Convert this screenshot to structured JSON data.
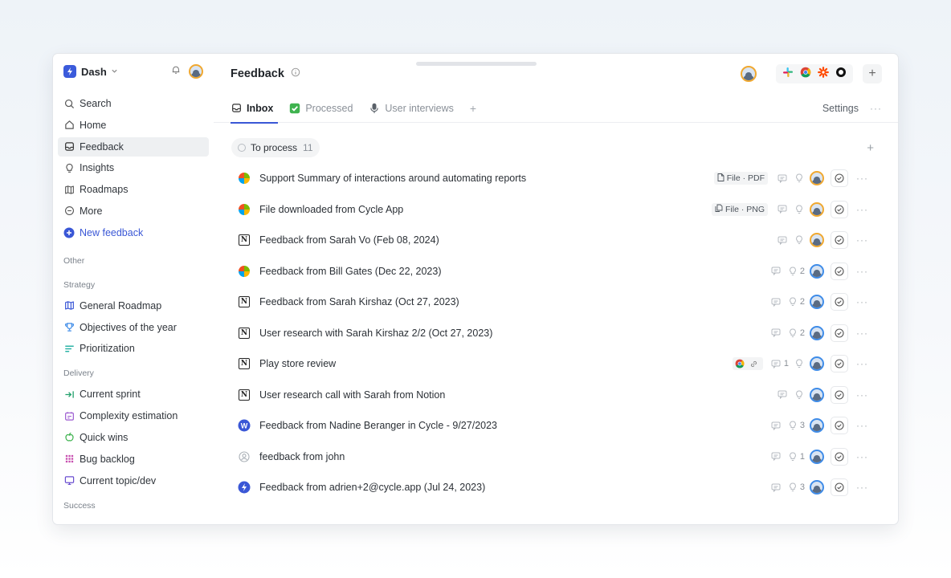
{
  "sidebar": {
    "workspace": "Dash",
    "nav": [
      {
        "label": "Search",
        "icon": "search-icon"
      },
      {
        "label": "Home",
        "icon": "home-icon"
      },
      {
        "label": "Feedback",
        "icon": "inbox-icon",
        "active": true
      },
      {
        "label": "Insights",
        "icon": "lightbulb-icon"
      },
      {
        "label": "Roadmaps",
        "icon": "map-icon"
      },
      {
        "label": "More",
        "icon": "more-circle-icon"
      },
      {
        "label": "New feedback",
        "icon": "plus-circle-icon"
      }
    ],
    "sections": {
      "other": "Other",
      "strategy": "Strategy",
      "delivery": "Delivery",
      "success": "Success"
    },
    "strategy_items": [
      {
        "label": "General Roadmap",
        "icon": "roadmap-icon",
        "color": "#3a57d6"
      },
      {
        "label": "Objectives of the year",
        "icon": "trophy-icon",
        "color": "#3f8ce8"
      },
      {
        "label": "Prioritization",
        "icon": "priority-icon",
        "color": "#2bb3a6"
      }
    ],
    "delivery_items": [
      {
        "label": "Current sprint",
        "icon": "sprint-icon",
        "color": "#22a06b"
      },
      {
        "label": "Complexity estimation",
        "icon": "calendar-icon",
        "color": "#9b59d0"
      },
      {
        "label": "Quick wins",
        "icon": "apple-icon",
        "color": "#3fb34f"
      },
      {
        "label": "Bug backlog",
        "icon": "bug-icon",
        "color": "#c84fb0"
      },
      {
        "label": "Current topic/dev",
        "icon": "screen-icon",
        "color": "#6b4fd0"
      }
    ]
  },
  "header": {
    "title": "Feedback",
    "settings_label": "Settings"
  },
  "tabs": [
    {
      "label": "Inbox",
      "icon": "inbox-icon",
      "active": true
    },
    {
      "label": "Processed",
      "icon": "check-box-icon",
      "active": false
    },
    {
      "label": "User interviews",
      "icon": "microphone-icon",
      "active": false
    }
  ],
  "group": {
    "label": "To process",
    "count": "11"
  },
  "rows": [
    {
      "title": "Support Summary of interactions around automating reports",
      "source": "microsoft-icon",
      "chip": "File · PDF",
      "chip_icon": "file-icon",
      "insights": "",
      "avatar": "orange"
    },
    {
      "title": "File downloaded from Cycle App",
      "source": "microsoft-icon",
      "chip": "File · PNG",
      "chip_icon": "files-icon",
      "insights": "",
      "avatar": "orange"
    },
    {
      "title": "Feedback from Sarah Vo (Feb 08, 2024)",
      "source": "notion-icon",
      "chip": "",
      "insights": "",
      "avatar": "orange"
    },
    {
      "title": "Feedback from Bill Gates (Dec 22, 2023)",
      "source": "microsoft-icon",
      "chip": "",
      "insights": "2",
      "avatar": "blue"
    },
    {
      "title": "Feedback from Sarah Kirshaz (Oct 27, 2023)",
      "source": "notion-icon",
      "chip": "",
      "insights": "2",
      "avatar": "blue"
    },
    {
      "title": "User research with Sarah Kirshaz 2/2 (Oct 27, 2023)",
      "source": "notion-icon",
      "chip": "",
      "insights": "2",
      "avatar": "blue"
    },
    {
      "title": "Play store review",
      "source": "notion-icon",
      "chip": "",
      "comments": "1",
      "insights": "",
      "avatar": "blue",
      "extra": "chrome-link"
    },
    {
      "title": "User research call with Sarah from Notion",
      "source": "notion-icon",
      "chip": "",
      "insights": "",
      "avatar": "blue"
    },
    {
      "title": "Feedback from Nadine Beranger in Cycle - 9/27/2023",
      "source": "cycle-w-icon",
      "chip": "",
      "insights": "3",
      "avatar": "blue"
    },
    {
      "title": "feedback from john",
      "source": "user-icon",
      "chip": "",
      "insights": "1",
      "avatar": "blue"
    },
    {
      "title": "Feedback from adrien+2@cycle.app (Jul 24, 2023)",
      "source": "cycle-bolt-icon",
      "chip": "",
      "insights": "3",
      "avatar": "blue"
    }
  ],
  "colors": {
    "accent": "#3a57d6",
    "avatar_orange": "#f0a830",
    "avatar_blue": "#3f8ce8"
  }
}
